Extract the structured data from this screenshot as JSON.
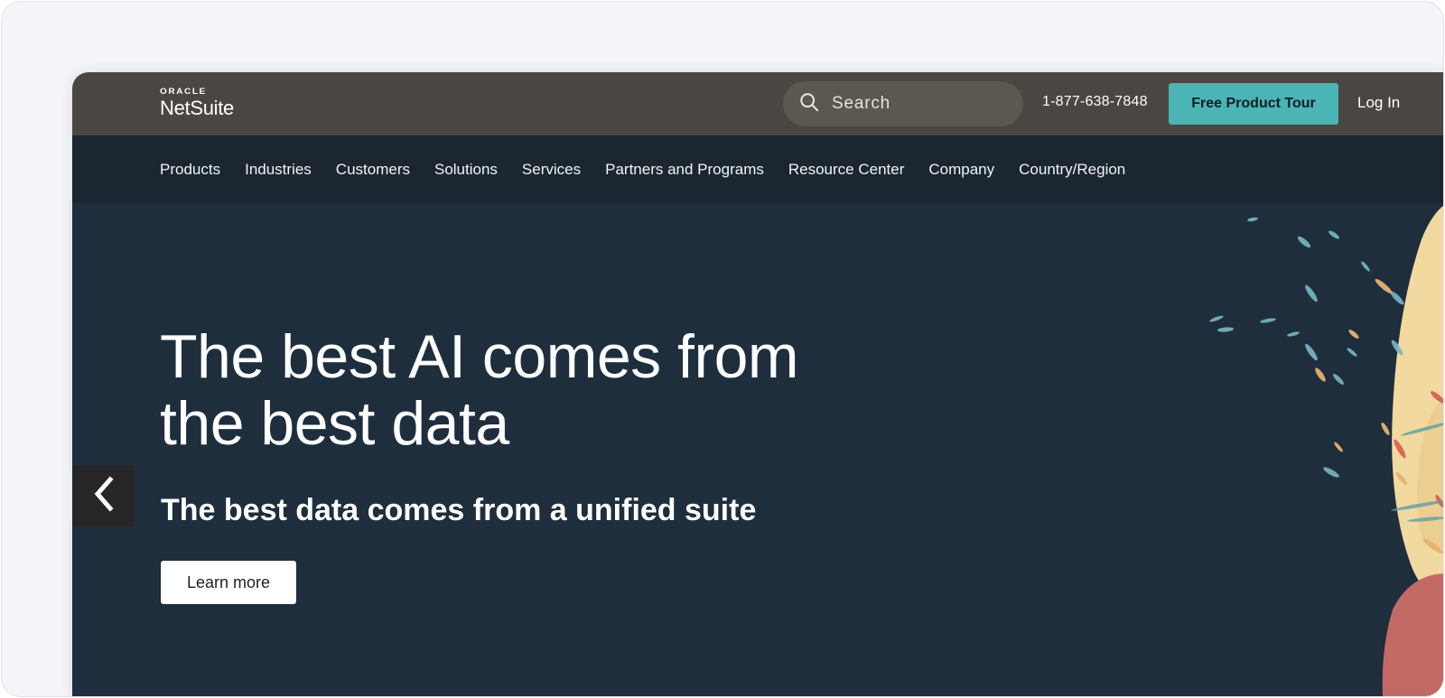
{
  "header": {
    "logo_top": "ORACLE",
    "logo_main": "NetSuite",
    "search_placeholder": "Search",
    "phone": "1-877-638-7848",
    "tour_label": "Free Product Tour",
    "login_label": "Log In"
  },
  "nav": {
    "items": [
      {
        "label": "Products"
      },
      {
        "label": "Industries"
      },
      {
        "label": "Customers"
      },
      {
        "label": "Solutions"
      },
      {
        "label": "Services"
      },
      {
        "label": "Partners and Programs"
      },
      {
        "label": "Resource Center"
      },
      {
        "label": "Company"
      },
      {
        "label": "Country/Region"
      }
    ]
  },
  "hero": {
    "title": "The best AI comes from the best data",
    "subtitle": "The best data comes from a unified suite",
    "cta_label": "Learn more"
  },
  "icons": {
    "search": "search-icon",
    "prev": "chevron-left-icon"
  },
  "colors": {
    "topbar": "#4a4641",
    "nav": "#1b2630",
    "hero": "#1e2e3d",
    "accent": "#4bb4b5"
  }
}
